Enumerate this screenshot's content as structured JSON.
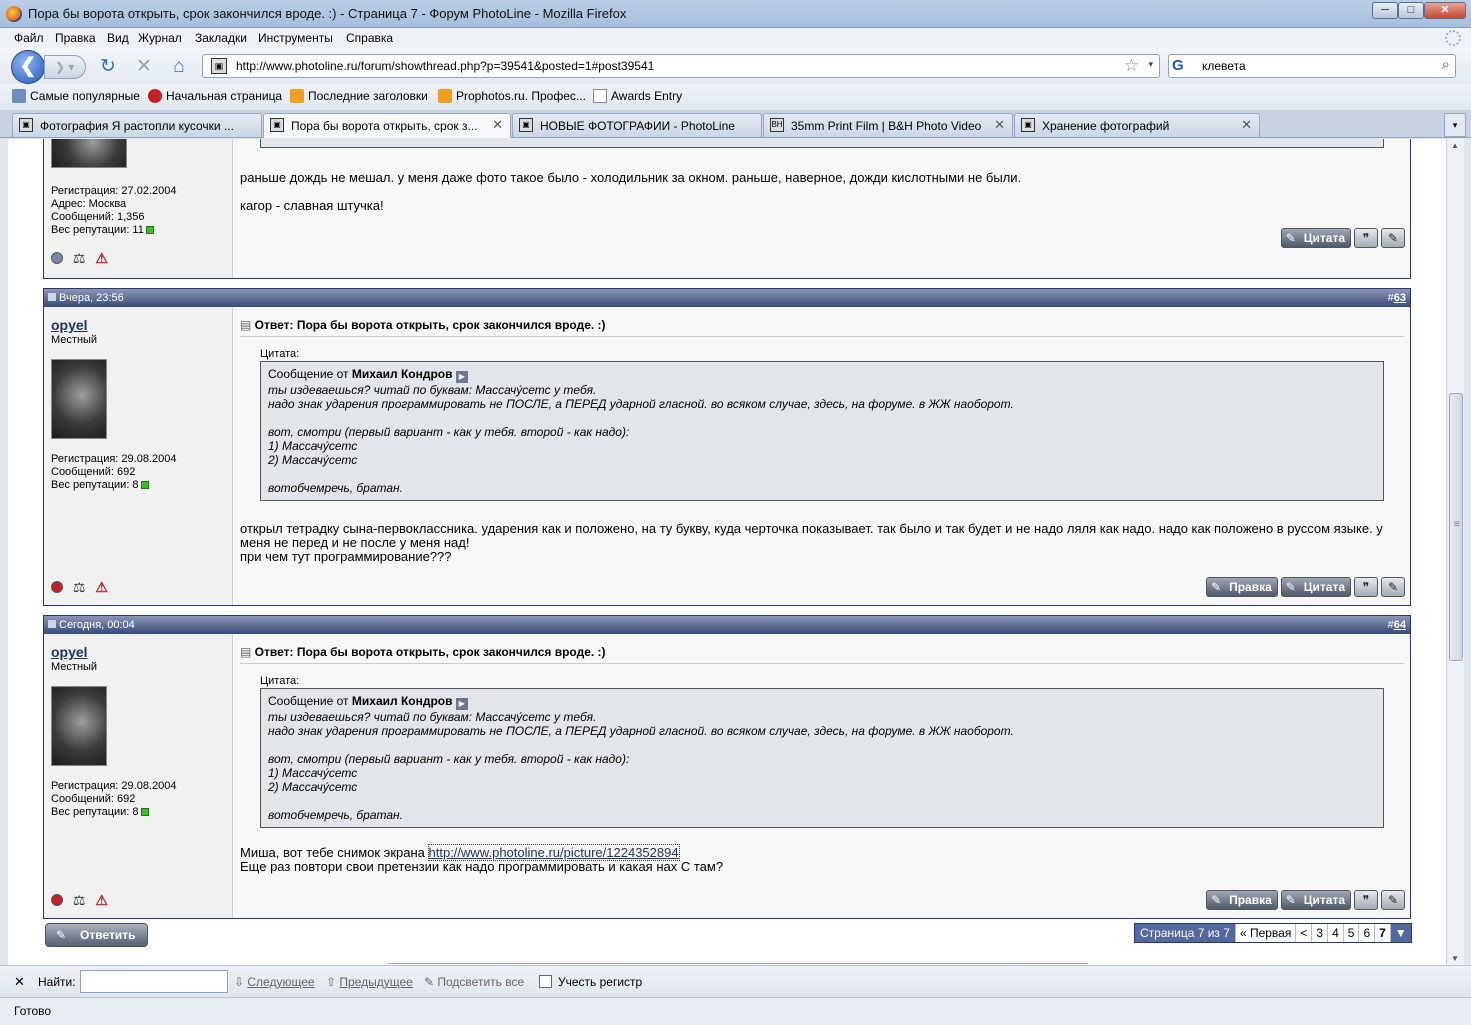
{
  "window": {
    "title": "Пора бы ворота открыть, срок закончился вроде. :) - Страница 7 - Форум PhotoLine - Mozilla Firefox",
    "min": "─",
    "max": "□",
    "close": "✕"
  },
  "menu": [
    "Файл",
    "Правка",
    "Вид",
    "Журнал",
    "Закладки",
    "Инструменты",
    "Справка"
  ],
  "nav": {
    "back": "❮",
    "forward": "❯ ▾",
    "reload": "↻",
    "stop": "✕",
    "home": "⌂",
    "url": "http://www.photoline.ru/forum/showthread.php?p=39541&posted=1#post39541",
    "star": "☆",
    "url_drop": "▾",
    "search_engine": "G",
    "search_query": "клевета",
    "search_go": "⌕"
  },
  "bookmarks": [
    {
      "label": "Самые популярные",
      "icon": "popular-icon"
    },
    {
      "label": "Начальная страница",
      "icon": "start-icon"
    },
    {
      "label": "Последние заголовки",
      "icon": "rss-icon"
    },
    {
      "label": "Prophotos.ru. Профес...",
      "icon": "rss-icon"
    },
    {
      "label": "Awards Entry",
      "icon": "page-icon"
    }
  ],
  "tabs": [
    {
      "label": "Фотография Я растопли кусочки ...",
      "active": false,
      "icon": "▣"
    },
    {
      "label": "Пора бы ворота открыть, срок з...",
      "active": true,
      "icon": "▣"
    },
    {
      "label": "НОВЫЕ ФОТОГРАФИИ - PhotoLine",
      "active": false,
      "icon": "▣"
    },
    {
      "label": "35mm Print Film | B&H Photo Video",
      "active": false,
      "icon": "BH"
    },
    {
      "label": "Хранение фотографий",
      "active": false,
      "icon": "▣"
    }
  ],
  "tab_close": "✕",
  "tab_list": "▾",
  "posts": [
    {
      "user_info": [
        "Регистрация: 27.02.2004",
        "Адрес: Москва",
        "Сообщений: 1,356",
        "Вес репутации: 11"
      ],
      "text": [
        "раньше дождь не мешал. у меня даже фото такое было - холодильник за окном. раньше, наверное, дожди кислотными не были.",
        "кагор - славная штучка!"
      ],
      "buttons": {
        "quote": "Цитата",
        "multi": "❞",
        "quick": "✎"
      },
      "icons": {
        "status": "◉",
        "scales": "⚖",
        "warn": "⚠"
      }
    },
    {
      "date": "Вчера, 23:56",
      "num_hash": "#",
      "num": "63",
      "username": "opyel",
      "rank": "Местный",
      "user_info": [
        "Регистрация: 29.08.2004",
        "Сообщений: 692",
        "Вес репутации: 8"
      ],
      "title": "Ответ: Пора бы ворота открыть, срок закончился вроде. :)",
      "quote_label": "Цитата:",
      "quote_prefix": "Сообщение от",
      "quote_author": "Михаил Кондров",
      "quote_lines": [
        "ты издеваешься? читай по буквам: Массачу́сетс у тебя.",
        "надо знак ударения программировать не ПОСЛЕ, а ПЕРЕД ударной гласной. во всяком случае, здесь, на форуме. в ЖЖ наоборот.",
        "",
        "вот, смотри (первый вариант - как у тебя. второй - как надо):",
        "1) Массачу́сетс",
        "2) Массачу́сетс",
        "",
        "вотобчемречь, братан."
      ],
      "text": [
        "открыл тетрадку сына-первоклассника. ударения как и положено, на ту букву, куда черточка показывает. так было и так будет и не надо ляля как надо. надо как положено в руссом языке. у меня не перед и не после у меня над!",
        "при чем тут программирование???"
      ],
      "buttons": {
        "edit": "Правка",
        "quote": "Цитата",
        "multi": "❞",
        "quick": "✎"
      }
    },
    {
      "date": "Сегодня, 00:04",
      "num_hash": "#",
      "num": "64",
      "username": "opyel",
      "rank": "Местный",
      "user_info": [
        "Регистрация: 29.08.2004",
        "Сообщений: 692",
        "Вес репутации: 8"
      ],
      "title": "Ответ: Пора бы ворота открыть, срок закончился вроде. :)",
      "quote_label": "Цитата:",
      "quote_prefix": "Сообщение от",
      "quote_author": "Михаил Кондров",
      "quote_lines": [
        "ты издеваешься? читай по буквам: Массачу́сетс у тебя.",
        "надо знак ударения программировать не ПОСЛЕ, а ПЕРЕД ударной гласной. во всяком случае, здесь, на форуме. в ЖЖ наоборот.",
        "",
        "вот, смотри (первый вариант - как у тебя. второй - как надо):",
        "1) Массачу́сетс",
        "2) Массачу́сетс",
        "",
        "вотобчемречь, братан."
      ],
      "text_prefix": "Миша, вот тебе снимок экрана",
      "link": "http://www.photoline.ru/picture/1224352894",
      "text2": "Еще раз повтори свои претензии как надо программировать и какая нах С там?",
      "buttons": {
        "edit": "Правка",
        "quote": "Цитата",
        "multi": "❞",
        "quick": "✎"
      }
    }
  ],
  "reply_button": "Ответить",
  "pager": {
    "info": "Страница 7 из 7",
    "first": "« Первая",
    "prev": "<",
    "pages": [
      "3",
      "4",
      "5",
      "6",
      "7"
    ],
    "current": "7",
    "menu": "▼"
  },
  "findbar": {
    "close": "✕",
    "label": "Найти:",
    "next": "Следующее",
    "prev": "Предыдущее",
    "highlight": "Подсветить все",
    "case": "Учесть регистр"
  },
  "status": "Готово"
}
